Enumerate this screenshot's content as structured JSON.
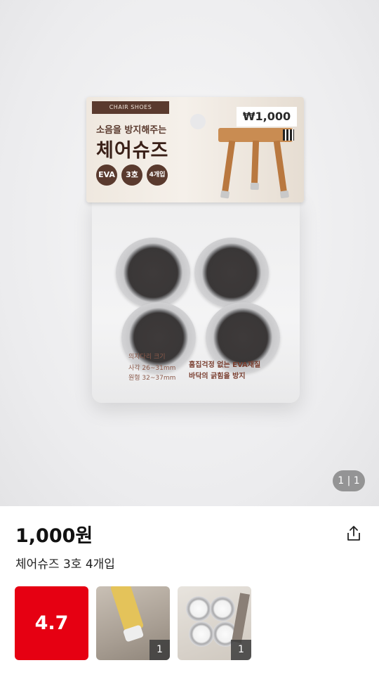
{
  "gallery": {
    "counter": "1 | 1",
    "product_image": {
      "brand_tag": "CHAIR SHOES",
      "tagline": "소음을 방지해주는",
      "name": "체어슈즈",
      "badges": [
        "EVA",
        "3호",
        "4개입"
      ],
      "price_tag": "₩1,000",
      "label_line1": "의자다리 크기",
      "label_line2": "사각 26~31mm",
      "label_line3": "원형 32~37mm",
      "label_bold1": "흠집걱정 없는 EVA재질",
      "label_bold2": "바닥의 긁힘을 방지"
    }
  },
  "product": {
    "price": "1,000원",
    "title": "체어슈즈 3호 4개입",
    "share_icon": "share-icon"
  },
  "reviews": {
    "rating": "4.7",
    "thumbnails": [
      {
        "count": "1"
      },
      {
        "count": "1"
      }
    ]
  },
  "colors": {
    "rating_bg": "#e60012",
    "packaging_brown": "#5a3a2e"
  }
}
